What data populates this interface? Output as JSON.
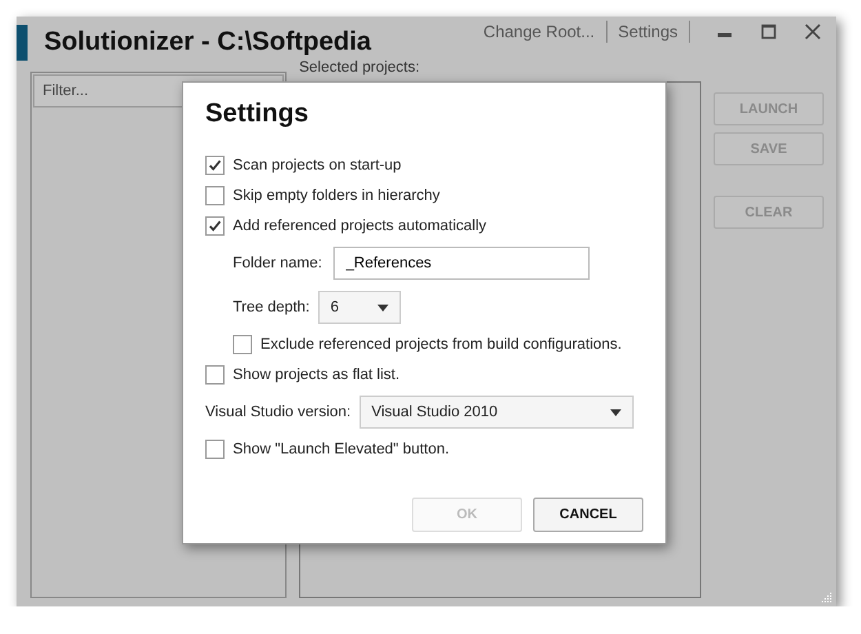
{
  "window": {
    "title": "Solutionizer - C:\\Softpedia",
    "links": [
      "Change Root...",
      "Settings"
    ]
  },
  "filter": {
    "placeholder": "Filter..."
  },
  "selected_projects": {
    "label": "Selected projects:"
  },
  "side_buttons": [
    {
      "label": "LAUNCH",
      "disabled": true
    },
    {
      "label": "SAVE",
      "disabled": true
    },
    {
      "label": "CLEAR",
      "disabled": true
    }
  ],
  "dialog": {
    "title": "Settings",
    "items": [
      {
        "kind": "checkbox",
        "label": "Scan projects on start-up",
        "checked": true
      },
      {
        "kind": "checkbox",
        "label": "Skip empty folders in hierarchy",
        "checked": false
      },
      {
        "kind": "checkbox",
        "label": "Add referenced projects automatically",
        "checked": true,
        "children": [
          {
            "kind": "field",
            "label": "Folder name:",
            "value": "_References"
          },
          {
            "kind": "dropdown",
            "label": "Tree depth:",
            "value": "6"
          },
          {
            "kind": "checkbox",
            "label": "Exclude referenced projects from build configurations.",
            "checked": false
          }
        ]
      },
      {
        "kind": "checkbox",
        "label": "Show projects as flat list.",
        "checked": false
      },
      {
        "kind": "wide-dropdown",
        "label": "Visual Studio version:",
        "value": "Visual Studio 2010"
      },
      {
        "kind": "checkbox",
        "label": "Show \"Launch Elevated\" button.",
        "checked": false
      }
    ],
    "buttons": [
      {
        "label": "OK",
        "disabled": true
      },
      {
        "label": "CANCEL",
        "disabled": false
      }
    ]
  }
}
